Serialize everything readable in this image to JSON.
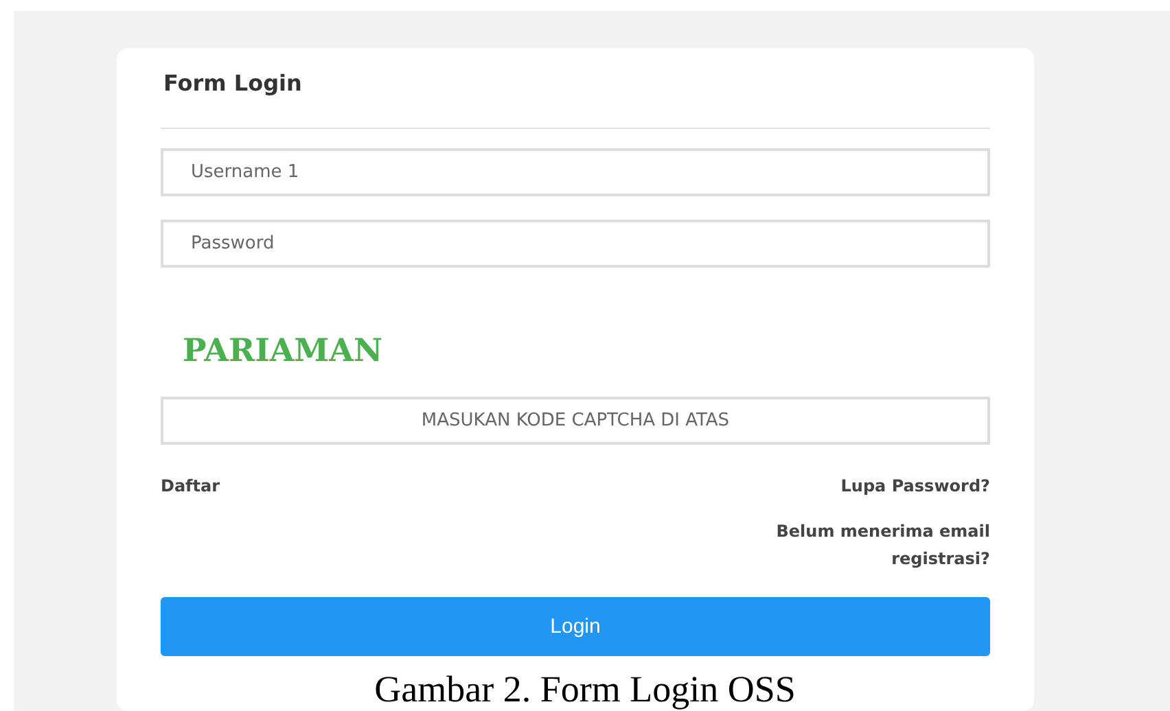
{
  "form": {
    "title": "Form Login",
    "fields": [
      {
        "placeholder": "Username 1"
      },
      {
        "placeholder": "Password"
      }
    ],
    "captcha_image_text": "PARIAMAN",
    "captcha_field": {
      "placeholder": "MASUKAN KODE CAPTCHA DI ATAS"
    },
    "links_left": [
      "Daftar"
    ],
    "links_right": [
      "Lupa Password?",
      "Belum menerima email registrasi?"
    ],
    "button": "Login"
  },
  "caption": "Gambar 2. Form Login OSS"
}
